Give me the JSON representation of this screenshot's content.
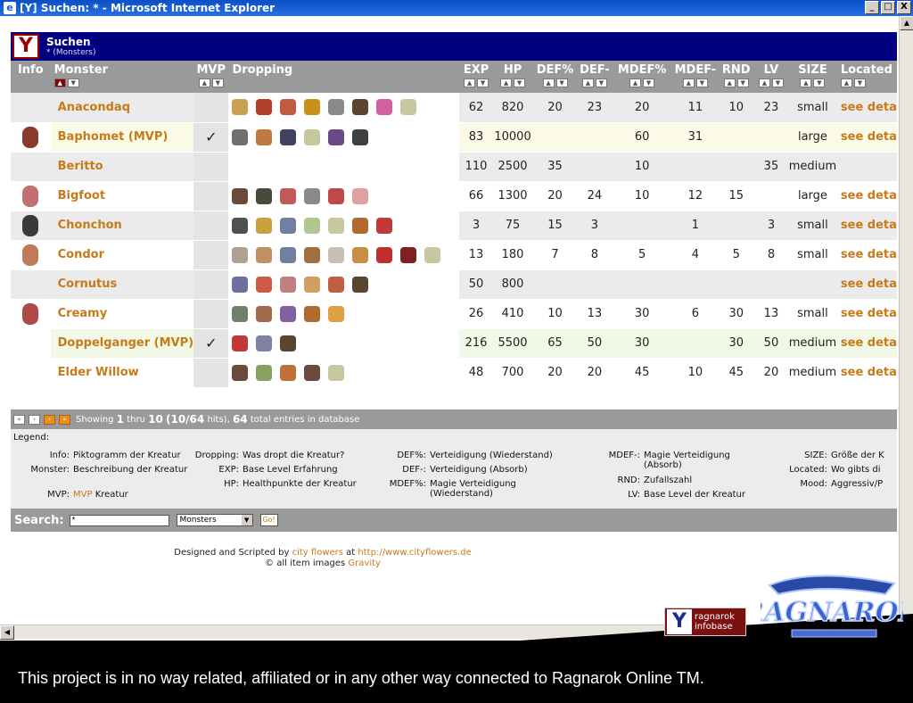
{
  "window": {
    "title": "[Y] Suchen: * - Microsoft Internet Explorer",
    "buttons": [
      "_",
      "□",
      "X"
    ]
  },
  "header": {
    "logo": "Y",
    "title": "Suchen",
    "subtitle": "* (Monsters)"
  },
  "columns": {
    "info": "Info",
    "monster": "Monster",
    "mvp": "MVP",
    "dropping": "Dropping",
    "exp": "EXP",
    "hp": "HP",
    "def_pct": "DEF%",
    "def": "DEF-",
    "mdef_pct": "MDEF%",
    "mdef": "MDEF-",
    "rnd": "RND",
    "lv": "LV",
    "size": "SIZE",
    "located": "Located"
  },
  "rows": [
    {
      "name": "Anacondaq",
      "mvp": "",
      "exp": "62",
      "hp": "820",
      "def_pct": "20",
      "def": "23",
      "mdef_pct": "20",
      "mdef": "11",
      "rnd": "10",
      "lv": "23",
      "size": "small",
      "located": "see deta",
      "style": "alt"
    },
    {
      "name": "Baphomet (MVP)",
      "mvp": "✓",
      "exp": "83",
      "hp": "10000",
      "def_pct": "",
      "def": "",
      "mdef_pct": "60",
      "mdef": "31",
      "rnd": "",
      "lv": "",
      "size": "large",
      "located": "see deta",
      "style": "mvp"
    },
    {
      "name": "Beritto",
      "mvp": "",
      "exp": "110",
      "hp": "2500",
      "def_pct": "35",
      "def": "",
      "mdef_pct": "10",
      "mdef": "",
      "rnd": "",
      "lv": "35",
      "size": "medium",
      "located": "",
      "style": "alt"
    },
    {
      "name": "Bigfoot",
      "mvp": "",
      "exp": "66",
      "hp": "1300",
      "def_pct": "20",
      "def": "24",
      "mdef_pct": "10",
      "mdef": "12",
      "rnd": "15",
      "lv": "",
      "size": "large",
      "located": "see deta",
      "style": "white"
    },
    {
      "name": "Chonchon",
      "mvp": "",
      "exp": "3",
      "hp": "75",
      "def_pct": "15",
      "def": "3",
      "mdef_pct": "",
      "mdef": "1",
      "rnd": "",
      "lv": "3",
      "size": "small",
      "located": "see deta",
      "style": "alt"
    },
    {
      "name": "Condor",
      "mvp": "",
      "exp": "13",
      "hp": "180",
      "def_pct": "7",
      "def": "8",
      "mdef_pct": "5",
      "mdef": "4",
      "rnd": "5",
      "lv": "8",
      "size": "small",
      "located": "see deta",
      "style": "white"
    },
    {
      "name": "Cornutus",
      "mvp": "",
      "exp": "50",
      "hp": "800",
      "def_pct": "",
      "def": "",
      "mdef_pct": "",
      "mdef": "",
      "rnd": "",
      "lv": "",
      "size": "",
      "located": "see deta",
      "style": "alt"
    },
    {
      "name": "Creamy",
      "mvp": "",
      "exp": "26",
      "hp": "410",
      "def_pct": "10",
      "def": "13",
      "mdef_pct": "30",
      "mdef": "6",
      "rnd": "30",
      "lv": "13",
      "size": "small",
      "located": "see deta",
      "style": "white"
    },
    {
      "name": "Doppelganger (MVP)",
      "mvp": "✓",
      "exp": "216",
      "hp": "5500",
      "def_pct": "65",
      "def": "50",
      "mdef_pct": "30",
      "mdef": "",
      "rnd": "30",
      "lv": "50",
      "size": "medium",
      "located": "see deta",
      "style": "mvp2"
    },
    {
      "name": "Elder Willow",
      "mvp": "",
      "exp": "48",
      "hp": "700",
      "def_pct": "20",
      "def": "20",
      "mdef_pct": "45",
      "mdef": "10",
      "rnd": "45",
      "lv": "20",
      "size": "medium",
      "located": "see deta",
      "style": "white"
    }
  ],
  "drops": [
    [
      "#c8a050",
      "#b0402a",
      "#c05a40",
      "#c8921a",
      "#8a8a8a",
      "#5a4530",
      "#d060a0",
      "#c8c8a0"
    ],
    [
      "#707070",
      "#c07a40",
      "#404060",
      "#c8c8a0",
      "#6a4a8a",
      "#404040"
    ],
    [],
    [
      "#6a4a3a",
      "#4a4a3a",
      "#c05a5a",
      "#8a8a8a",
      "#c04a4a",
      "#e0a0a0"
    ],
    [
      "#505050",
      "#c8a040",
      "#7080a0",
      "#b0c890",
      "#c8c8a0",
      "#b06a30",
      "#c03a3a"
    ],
    [
      "#b0a090",
      "#c09060",
      "#7080a0",
      "#a07040",
      "#c8c0b0",
      "#c89040",
      "#c03030",
      "#802020",
      "#c8c8a0"
    ],
    [
      "#7070a0",
      "#d05a4a",
      "#c08080",
      "#d0a060",
      "#c06040",
      "#5a4530"
    ],
    [
      "#70806a",
      "#a06a4a",
      "#8060a0",
      "#b06a30",
      "#e0a040"
    ],
    [
      "#c03a3a",
      "#8080a0",
      "#5a4530"
    ],
    [
      "#6a4a3a",
      "#8aa060",
      "#c0703a",
      "#6a4a3a",
      "#c8c8a0"
    ]
  ],
  "creatures": [
    "",
    "#8a3a2a",
    "",
    "#c07070",
    "#3a3a3a",
    "#c07a5a",
    "",
    "#b04a4a",
    "",
    ""
  ],
  "pager": {
    "showing": "Showing",
    "from": "1",
    "thru": "thru",
    "to": "10",
    "hits": "(10/64",
    "hits_label": "hits),",
    "total": "64",
    "total_label": "total entries in database"
  },
  "legend": {
    "title": "Legend:",
    "items": [
      {
        "k": "Info:",
        "v": "Piktogramm der Kreatur"
      },
      {
        "k": "Monster:",
        "v": "Beschreibung der Kreatur"
      },
      {
        "k": "MVP:",
        "v": "Kreatur",
        "mvp": "MVP"
      },
      {
        "k": "Dropping:",
        "v": "Was dropt die Kreatur?"
      },
      {
        "k": "EXP:",
        "v": "Base Level Erfahrung"
      },
      {
        "k": "HP:",
        "v": "Healthpunkte der Kreatur"
      },
      {
        "k": "DEF%:",
        "v": "Verteidigung (Wiederstand)"
      },
      {
        "k": "DEF-:",
        "v": "Verteidigung (Absorb)"
      },
      {
        "k": "MDEF%:",
        "v": "Magie Verteidigung (Wiederstand)"
      },
      {
        "k": "MDEF-:",
        "v": "Magie Verteidigung (Absorb)"
      },
      {
        "k": "RND:",
        "v": "Zufallszahl"
      },
      {
        "k": "LV:",
        "v": "Base Level der Kreatur"
      },
      {
        "k": "SIZE:",
        "v": "Größe der K"
      },
      {
        "k": "Located:",
        "v": "Wo gibts di"
      },
      {
        "k": "Mood:",
        "v": "Aggressiv/P"
      }
    ]
  },
  "search": {
    "label": "Search:",
    "value": "*",
    "select": "Monsters",
    "go": "Go!"
  },
  "credits": {
    "line1_a": "Designed and Scripted by",
    "line1_b": "city flowers",
    "line1_c": "at",
    "line1_d": "http://www.cityflowers.de",
    "line2_a": "© all item images",
    "line2_b": "Gravity"
  },
  "infobox": {
    "logo": "Y",
    "line1": "ragnarok",
    "line2": "infobase"
  },
  "ro_logo": "RAGNAROK",
  "disclaimer": "This project is in no way related, affiliated or in any other way connected to Ragnarok Online TM.",
  "colors": {
    "accent": "#c77a1a",
    "header": "#000080",
    "grid_header": "#9a9a9a"
  }
}
